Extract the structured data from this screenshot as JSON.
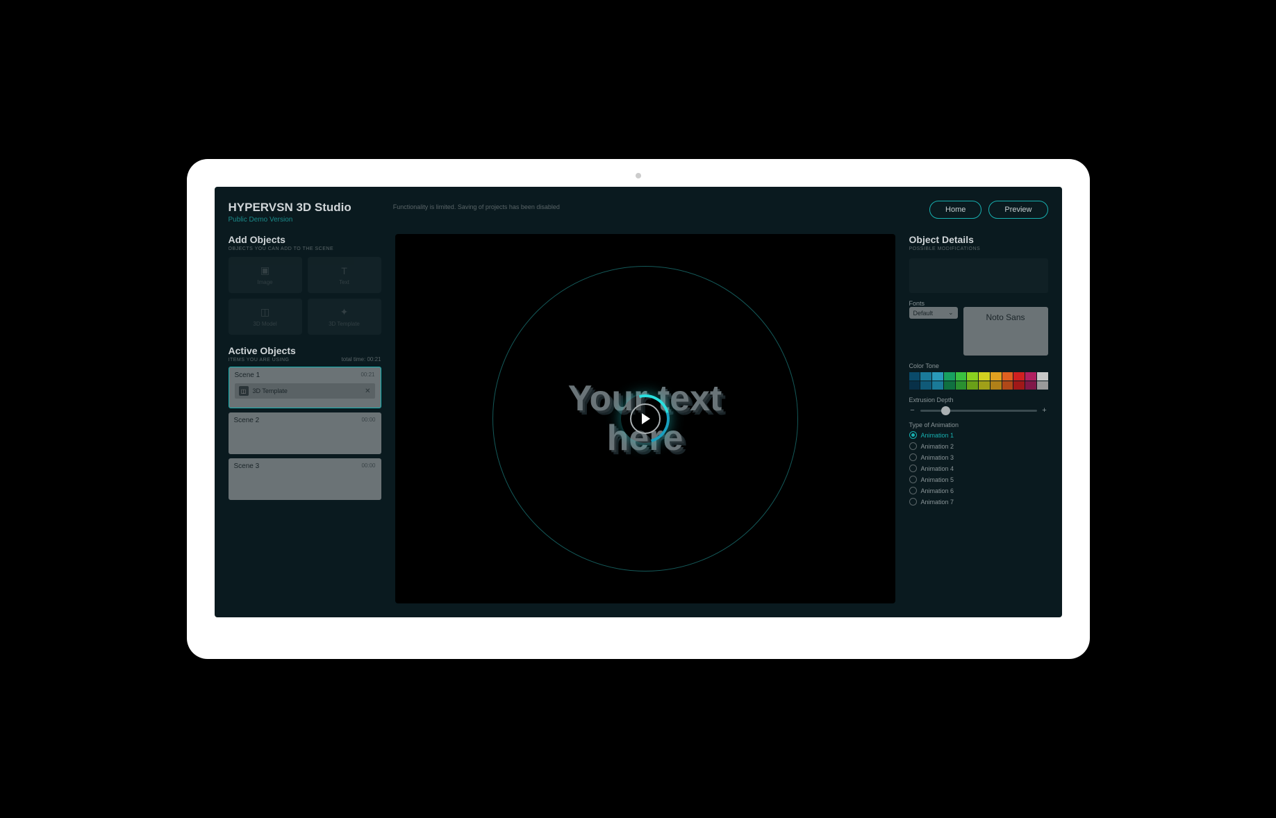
{
  "brand": {
    "title": "HYPERVSN 3D Studio",
    "subtitle": "Public Demo Version"
  },
  "notice": "Functionality is limited. Saving of projects has been disabled",
  "buttons": {
    "home": "Home",
    "preview": "Preview"
  },
  "addObjects": {
    "title": "Add Objects",
    "subtitle": "OBJECTS YOU CAN ADD TO THE SCENE",
    "items": {
      "image": "Image",
      "text": "Text",
      "model": "3D Model",
      "template": "3D Template"
    }
  },
  "activeObjects": {
    "title": "Active Objects",
    "subtitle": "ITEMS YOU ARE USING",
    "totalLabel": "total time:",
    "totalTime": "00:21",
    "scenes": [
      {
        "name": "Scene 1",
        "time": "00:21",
        "item": "3D Template"
      },
      {
        "name": "Scene 2",
        "time": "00:00"
      },
      {
        "name": "Scene 3",
        "time": "00:00"
      }
    ]
  },
  "canvas": {
    "line1": "Your text",
    "line2": "here"
  },
  "details": {
    "title": "Object Details",
    "subtitle": "POSSIBLE MODIFICATIONS",
    "fontsLabel": "Fonts",
    "fontSelected": "Default",
    "fontPreview": "Noto Sans",
    "colorLabel": "Color Tone",
    "colors": [
      "#0a4a6a",
      "#1a7a9a",
      "#2a9aba",
      "#18a060",
      "#3ac040",
      "#8ad020",
      "#d0d020",
      "#e0a020",
      "#e06020",
      "#d02020",
      "#b02060",
      "#c8c8c8",
      "#083048",
      "#105a78",
      "#1a7a98",
      "#107040",
      "#2a9030",
      "#6aa018",
      "#a0a018",
      "#b08018",
      "#b04818",
      "#a01818",
      "#801848",
      "#9a9a9a"
    ],
    "depthLabel": "Extrusion Depth",
    "animLabel": "Type of Animation",
    "animations": [
      "Animation 1",
      "Animation 2",
      "Animation 3",
      "Animation 4",
      "Animation 5",
      "Animation 6",
      "Animation 7"
    ],
    "animSelected": 0
  }
}
